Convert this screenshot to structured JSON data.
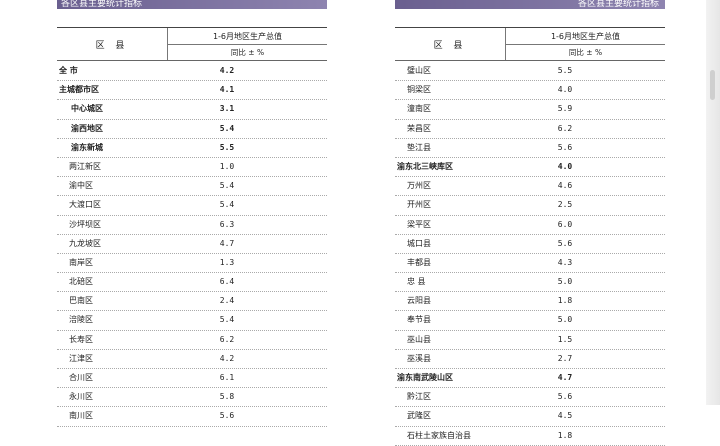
{
  "left_page": {
    "banner": "各区县主要统计指标",
    "header": {
      "district": "区  县",
      "metric": "1-6月地区生产总值",
      "sub": "同比 ± %"
    },
    "rows": [
      {
        "name": "全    市",
        "value": "4.2",
        "level": 0,
        "bold": true
      },
      {
        "name": "主城都市区",
        "value": "4.1",
        "level": 0,
        "bold": true
      },
      {
        "name": "中心城区",
        "value": "3.1",
        "level": 1,
        "bold": true
      },
      {
        "name": "渝西地区",
        "value": "5.4",
        "level": 1,
        "bold": true
      },
      {
        "name": "渝东新城",
        "value": "5.5",
        "level": 1,
        "bold": true
      },
      {
        "name": "两江新区",
        "value": "1.0",
        "level": 2,
        "bold": false
      },
      {
        "name": "渝中区",
        "value": "5.4",
        "level": 2,
        "bold": false
      },
      {
        "name": "大渡口区",
        "value": "5.4",
        "level": 2,
        "bold": false
      },
      {
        "name": "沙坪坝区",
        "value": "6.3",
        "level": 2,
        "bold": false
      },
      {
        "name": "九龙坡区",
        "value": "4.7",
        "level": 2,
        "bold": false
      },
      {
        "name": "南岸区",
        "value": "1.3",
        "level": 2,
        "bold": false
      },
      {
        "name": "北碚区",
        "value": "6.4",
        "level": 2,
        "bold": false
      },
      {
        "name": "巴南区",
        "value": "2.4",
        "level": 2,
        "bold": false
      },
      {
        "name": "涪陵区",
        "value": "5.4",
        "level": 2,
        "bold": false
      },
      {
        "name": "长寿区",
        "value": "6.2",
        "level": 2,
        "bold": false
      },
      {
        "name": "江津区",
        "value": "4.2",
        "level": 2,
        "bold": false
      },
      {
        "name": "合川区",
        "value": "6.1",
        "level": 2,
        "bold": false
      },
      {
        "name": "永川区",
        "value": "5.8",
        "level": 2,
        "bold": false
      },
      {
        "name": "南川区",
        "value": "5.6",
        "level": 2,
        "bold": false
      }
    ]
  },
  "right_page": {
    "banner": "各区县主要统计指标",
    "header": {
      "district": "区  县",
      "metric": "1-6月地区生产总值",
      "sub": "同比 ± %"
    },
    "rows": [
      {
        "name": "璧山区",
        "value": "5.5",
        "level": 2,
        "bold": false
      },
      {
        "name": "铜梁区",
        "value": "4.0",
        "level": 2,
        "bold": false
      },
      {
        "name": "潼南区",
        "value": "5.9",
        "level": 2,
        "bold": false
      },
      {
        "name": "荣昌区",
        "value": "6.2",
        "level": 2,
        "bold": false
      },
      {
        "name": "垫江县",
        "value": "5.6",
        "level": 2,
        "bold": false
      },
      {
        "name": "渝东北三峡库区",
        "value": "4.0",
        "level": 0,
        "bold": true
      },
      {
        "name": "万州区",
        "value": "4.6",
        "level": 2,
        "bold": false
      },
      {
        "name": "开州区",
        "value": "2.5",
        "level": 2,
        "bold": false
      },
      {
        "name": "梁平区",
        "value": "6.0",
        "level": 2,
        "bold": false
      },
      {
        "name": "城口县",
        "value": "5.6",
        "level": 2,
        "bold": false
      },
      {
        "name": "丰都县",
        "value": "4.3",
        "level": 2,
        "bold": false
      },
      {
        "name": "忠  县",
        "value": "5.0",
        "level": 2,
        "bold": false
      },
      {
        "name": "云阳县",
        "value": "1.8",
        "level": 2,
        "bold": false
      },
      {
        "name": "奉节县",
        "value": "5.0",
        "level": 2,
        "bold": false
      },
      {
        "name": "巫山县",
        "value": "1.5",
        "level": 2,
        "bold": false
      },
      {
        "name": "巫溪县",
        "value": "2.7",
        "level": 2,
        "bold": false
      },
      {
        "name": "渝东南武陵山区",
        "value": "4.7",
        "level": 0,
        "bold": true
      },
      {
        "name": "黔江区",
        "value": "5.6",
        "level": 2,
        "bold": false
      },
      {
        "name": "武隆区",
        "value": "4.5",
        "level": 2,
        "bold": false
      },
      {
        "name": "石柱土家族自治县",
        "value": "1.8",
        "level": 2,
        "bold": false
      }
    ]
  }
}
